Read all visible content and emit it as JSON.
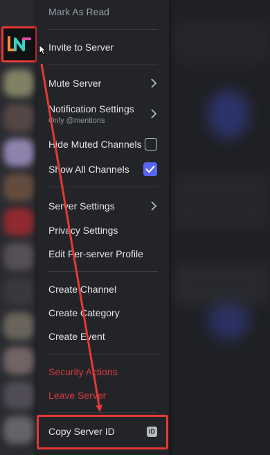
{
  "menu": {
    "mark_as_read": "Mark As Read",
    "invite": "Invite to Server",
    "mute": "Mute Server",
    "notification": "Notification Settings",
    "notification_sub": "Only @mentions",
    "hide_muted": "Hide Muted Channels",
    "show_all": "Show All Channels",
    "server_settings": "Server Settings",
    "privacy": "Privacy Settings",
    "edit_profile": "Edit Per-server Profile",
    "create_channel": "Create Channel",
    "create_category": "Create Category",
    "create_event": "Create Event",
    "security": "Security Actions",
    "leave": "Leave Server",
    "copy_id": "Copy Server ID",
    "copy_id_badge": "ID"
  },
  "state": {
    "hide_muted_checked": false,
    "show_all_checked": true
  },
  "colors": {
    "annotation": "#e53935",
    "checkbox_on": "#5865f2",
    "danger": "#f23f42"
  },
  "icons": {
    "guild": "server-logo-icon",
    "chevron": "chevron-right-icon",
    "check": "checkmark-icon",
    "badge": "id-badge-icon",
    "cursor": "mouse-cursor-icon"
  }
}
